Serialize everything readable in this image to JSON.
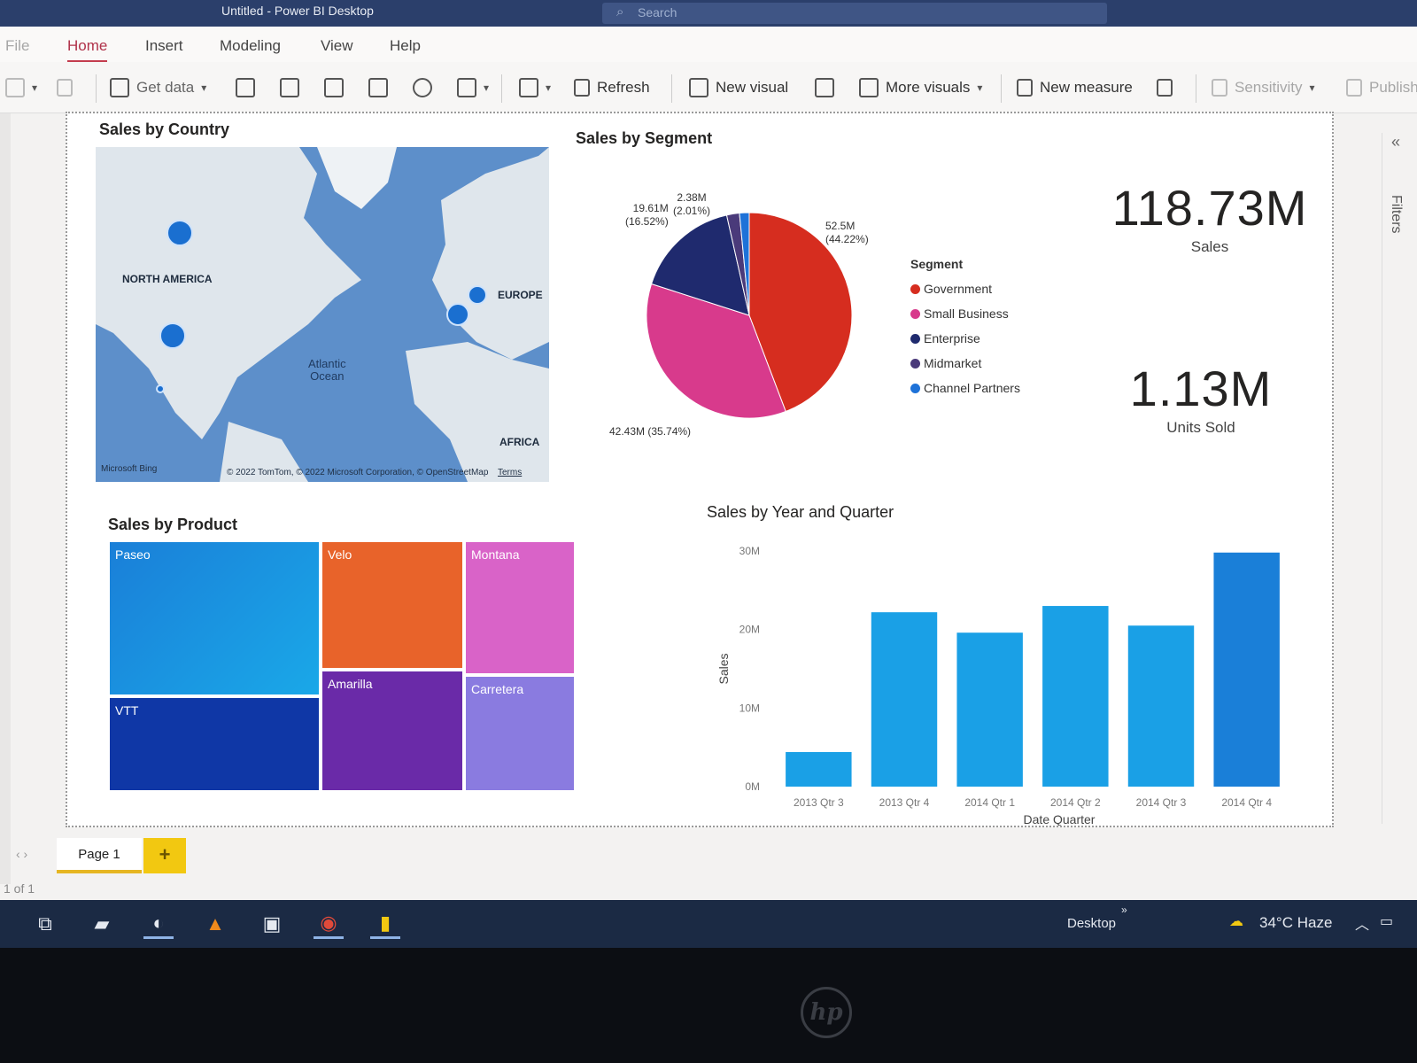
{
  "window": {
    "title": "Untitled - Power BI Desktop",
    "search_placeholder": "Search"
  },
  "menu": {
    "file": "File",
    "home": "Home",
    "insert": "Insert",
    "modeling": "Modeling",
    "view": "View",
    "help": "Help"
  },
  "ribbon": {
    "get_data": "Get data",
    "refresh": "Refresh",
    "new_visual": "New visual",
    "more_visuals": "More visuals",
    "new_measure": "New measure",
    "sensitivity": "Sensitivity",
    "publish": "Publish"
  },
  "filters_pane": {
    "label": "Filters"
  },
  "map_visual": {
    "title": "Sales by Country",
    "labels": {
      "north_america": "NORTH AMERICA",
      "europe": "EUROPE",
      "africa": "AFRICA",
      "ocean_line1": "Atlantic",
      "ocean_line2": "Ocean"
    },
    "bing": "Microsoft Bing",
    "copyright": "© 2022 TomTom, © 2022 Microsoft Corporation, © OpenStreetMap",
    "terms": "Terms"
  },
  "pie_visual": {
    "title": "Sales by Segment",
    "legend_title": "Segment",
    "labels": {
      "government": [
        "52.5M",
        "(44.22%)"
      ],
      "small_business": "42.43M (35.74%)",
      "enterprise": [
        "19.61M",
        "(16.52%)"
      ],
      "channel": [
        "2.38M",
        "(2.01%)"
      ]
    }
  },
  "cards": {
    "sales": {
      "value": "118.73M",
      "label": "Sales"
    },
    "units": {
      "value": "1.13M",
      "label": "Units Sold"
    }
  },
  "treemap": {
    "title": "Sales by Product",
    "tiles": [
      "Paseo",
      "VTT",
      "Velo",
      "Amarilla",
      "Montana",
      "Carretera"
    ]
  },
  "pages": {
    "tab": "Page 1",
    "add": "+",
    "status": "1 of 1"
  },
  "taskbar": {
    "desktop": "Desktop",
    "chevron": "»",
    "weather": "34°C  Haze"
  },
  "colors": {
    "government": "#d62d1f",
    "small_business": "#d83a8c",
    "enterprise": "#1f2a6e",
    "midmarket": "#4a3a7a",
    "channel_partners": "#1e72d8",
    "bar": "#1aa0e6",
    "accent": "#f2c811"
  },
  "chart_data": [
    {
      "type": "pie",
      "title": "Sales by Segment",
      "legend_title": "Segment",
      "legend_position": "right",
      "slices": [
        {
          "name": "Government",
          "value": 52.5,
          "percent": 44.22,
          "color": "#d62d1f"
        },
        {
          "name": "Small Business",
          "value": 42.43,
          "percent": 35.74,
          "color": "#d83a8c"
        },
        {
          "name": "Enterprise",
          "value": 19.61,
          "percent": 16.52,
          "color": "#1f2a6e"
        },
        {
          "name": "Midmarket",
          "value": 2.38,
          "percent": 2.01,
          "color": "#4a3a7a"
        },
        {
          "name": "Channel Partners",
          "value": 1.81,
          "percent": 1.52,
          "color": "#1e72d8"
        }
      ]
    },
    {
      "type": "bar",
      "title": "Sales by Year and Quarter",
      "xlabel": "Date Quarter",
      "ylabel": "Sales",
      "categories": [
        "2013 Qtr 3",
        "2013 Qtr 4",
        "2014 Qtr 1",
        "2014 Qtr 2",
        "2014 Qtr 3",
        "2014 Qtr 4"
      ],
      "values": [
        4.4,
        22.2,
        19.6,
        23,
        20.5,
        29.8
      ],
      "ylim": [
        0,
        30
      ],
      "yticks": [
        "0M",
        "10M",
        "20M",
        "30M"
      ],
      "grid": false
    },
    {
      "type": "treemap",
      "title": "Sales by Product",
      "categories": [
        "Paseo",
        "VTT",
        "Velo",
        "Amarilla",
        "Montana",
        "Carretera"
      ],
      "values": [
        33,
        20.5,
        18.2,
        17.7,
        15.4,
        14
      ]
    }
  ]
}
